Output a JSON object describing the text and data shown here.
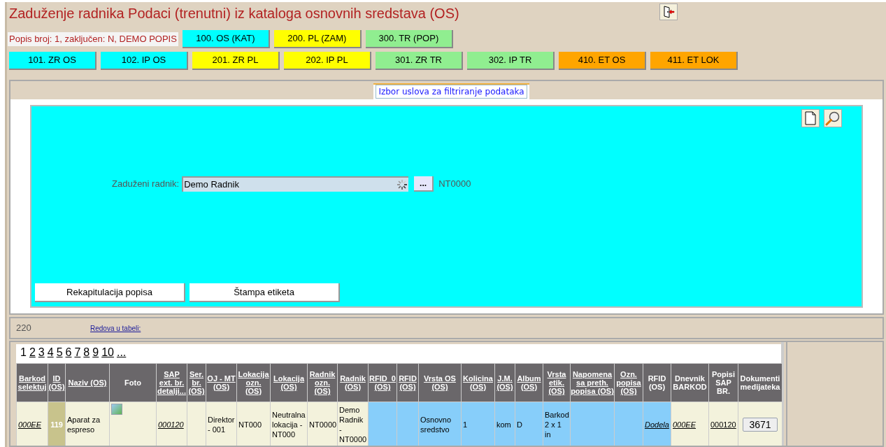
{
  "title": "Zaduženje radnika Podaci (trenutni) iz kataloga osnovnih sredstava (OS)",
  "popis_info": "Popis broj: 1, zaključen: N, DEMO POPIS",
  "nav_row_1": [
    {
      "label": "100. OS (KAT)",
      "color": "#00ffff"
    },
    {
      "label": "200. PL (ZAM)",
      "color": "#ffff00"
    },
    {
      "label": "300. TR (POP)",
      "color": "#90ee90"
    }
  ],
  "nav_row_2": [
    {
      "label": "101. ZR OS",
      "color": "#00ffff"
    },
    {
      "label": "102. IP OS",
      "color": "#00ffff"
    },
    {
      "label": "201. ZR PL",
      "color": "#ffff00"
    },
    {
      "label": "202. IP PL",
      "color": "#ffff00"
    },
    {
      "label": "301. ZR TR",
      "color": "#90ee90"
    },
    {
      "label": "302. IP TR",
      "color": "#90ee90"
    },
    {
      "label": "410. ET OS",
      "color": "#ffa500"
    },
    {
      "label": "411. ET LOK",
      "color": "#ffa500"
    }
  ],
  "filter_tab": "Izbor uslova za filtriranje podataka",
  "filter": {
    "label": "Zaduženi radnik:",
    "value": "Demo Radnik",
    "browse": "...",
    "code": "NT0000"
  },
  "actions": [
    "Rekapitulacija popisa",
    "Štampa etiketa"
  ],
  "row_count": {
    "value": "220",
    "label": "Redova u tabeli:"
  },
  "pages": [
    {
      "label": "1",
      "selected": true
    },
    {
      "label": "2",
      "selected": false
    },
    {
      "label": "3",
      "selected": false
    },
    {
      "label": "4",
      "selected": false
    },
    {
      "label": "5",
      "selected": false
    },
    {
      "label": "6",
      "selected": false
    },
    {
      "label": "7",
      "selected": false
    },
    {
      "label": "8",
      "selected": false
    },
    {
      "label": "9",
      "selected": false
    },
    {
      "label": "10",
      "selected": false
    },
    {
      "label": "...",
      "selected": false
    }
  ],
  "table": {
    "columns": [
      {
        "label": "Barkod selektuj",
        "sortable": true
      },
      {
        "label": "ID (OS)",
        "sortable": true
      },
      {
        "label": "Naziv (OS)",
        "sortable": true
      },
      {
        "label": "Foto",
        "sortable": false
      },
      {
        "label": "SAP ext. br. detalji...",
        "sortable": true
      },
      {
        "label": "Ser. br. (OS)",
        "sortable": true
      },
      {
        "label": "OJ - MT (OS)",
        "sortable": true
      },
      {
        "label": "Lokacija ozn. (OS)",
        "sortable": true
      },
      {
        "label": "Lokacija (OS)",
        "sortable": true
      },
      {
        "label": "Radnik ozn. (OS)",
        "sortable": true
      },
      {
        "label": "Radnik (OS)",
        "sortable": true
      },
      {
        "label": "RFID_0 (OS)",
        "sortable": true
      },
      {
        "label": "RFID (OS)",
        "sortable": true
      },
      {
        "label": "Vrsta OS (OS)",
        "sortable": true
      },
      {
        "label": "Kolicina (OS)",
        "sortable": true
      },
      {
        "label": "J.M. (OS)",
        "sortable": true
      },
      {
        "label": "Album (OS)",
        "sortable": true
      },
      {
        "label": "Vrsta etik. (OS)",
        "sortable": true
      },
      {
        "label": "Napomena sa preth. popisa (OS)",
        "sortable": true
      },
      {
        "label": "Ozn. popisa (OS)",
        "sortable": true
      },
      {
        "label": "RFID (OS)",
        "sortable": false
      },
      {
        "label": "Dnevnik BARKOD",
        "sortable": false
      },
      {
        "label": "Popisi SAP BR.",
        "sortable": false
      },
      {
        "label": "Dokumenti medijateka",
        "sortable": false
      }
    ],
    "rows": [
      [
        {
          "kind": "link",
          "text": "000EE",
          "highlighted": false
        },
        {
          "kind": "id",
          "text": "119",
          "highlighted": false
        },
        {
          "kind": "text",
          "text": "Aparat za espreso",
          "highlighted": false
        },
        {
          "kind": "image",
          "highlighted": false
        },
        {
          "kind": "link",
          "text": "000120",
          "highlighted": false
        },
        {
          "kind": "empty",
          "highlighted": false
        },
        {
          "kind": "text",
          "text": "Direktor - 001",
          "highlighted": false
        },
        {
          "kind": "text",
          "text": "NT000",
          "highlighted": false
        },
        {
          "kind": "text",
          "text": "Neutralna lokacija - NT000",
          "highlighted": false
        },
        {
          "kind": "text",
          "text": "NT0000",
          "highlighted": false
        },
        {
          "kind": "text",
          "text": "Demo Radnik - NT0000",
          "highlighted": false
        },
        {
          "kind": "empty",
          "highlighted": true
        },
        {
          "kind": "empty",
          "highlighted": true
        },
        {
          "kind": "text",
          "text": "Osnovno sredstvo",
          "highlighted": true
        },
        {
          "kind": "text",
          "text": "1",
          "highlighted": true
        },
        {
          "kind": "text",
          "text": "kom",
          "highlighted": true
        },
        {
          "kind": "text",
          "text": "D",
          "highlighted": true
        },
        {
          "kind": "text",
          "text": "Barkod 2 x 1 in",
          "highlighted": true
        },
        {
          "kind": "empty",
          "highlighted": true
        },
        {
          "kind": "empty",
          "highlighted": true
        },
        {
          "kind": "link",
          "text": "Dodela",
          "highlighted": true
        },
        {
          "kind": "link",
          "text": "000EE",
          "highlighted": false
        },
        {
          "kind": "plainlink",
          "text": "000120",
          "highlighted": false
        },
        {
          "kind": "button",
          "text": "3671",
          "highlighted": false
        }
      ]
    ]
  }
}
